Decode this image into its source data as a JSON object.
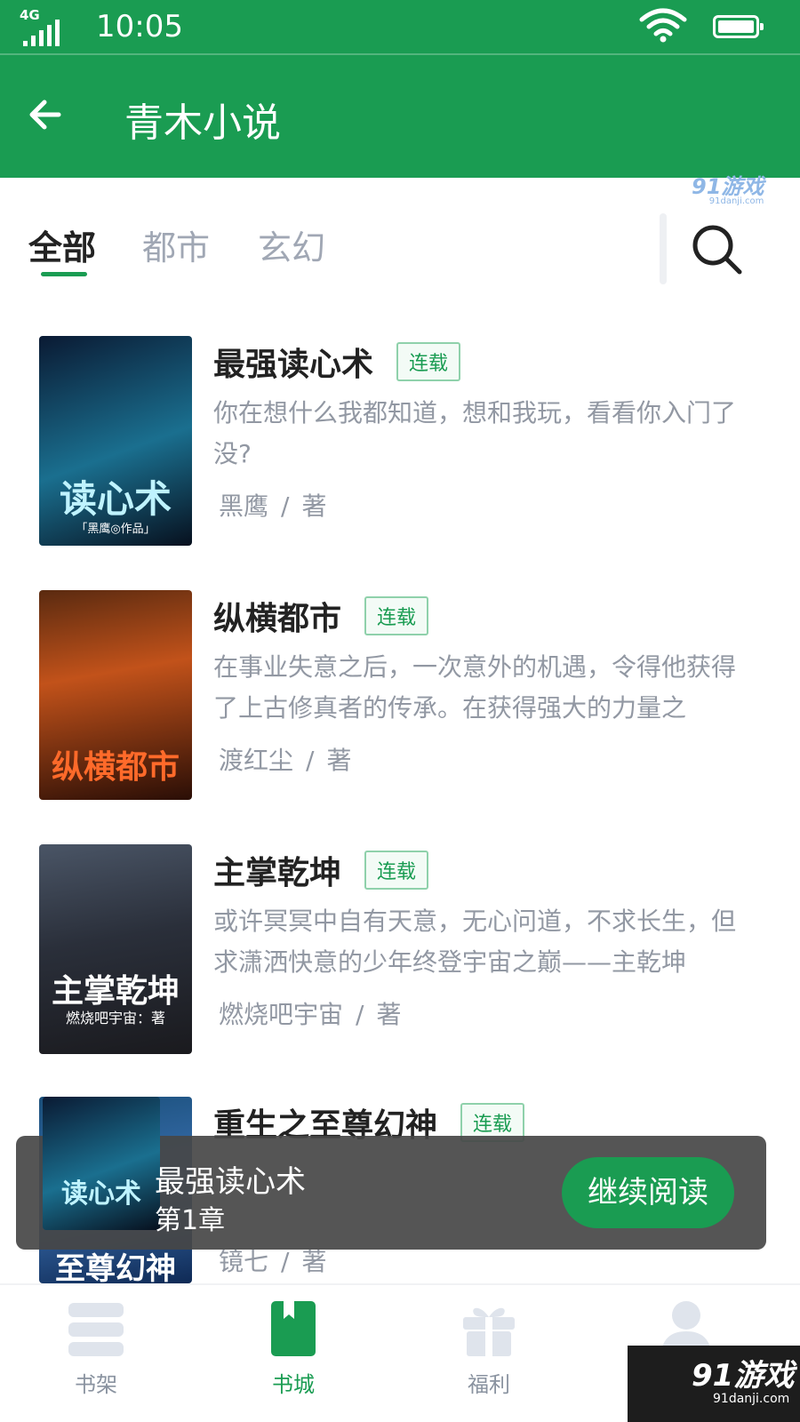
{
  "status_bar": {
    "network": "4G",
    "time": "10:05"
  },
  "app_bar": {
    "title": "青木小说"
  },
  "watermark_top": {
    "brand": "91游戏",
    "site": "91danji.com"
  },
  "tabs": [
    {
      "label": "全部",
      "active": true
    },
    {
      "label": "都市",
      "active": false
    },
    {
      "label": "玄幻",
      "active": false
    }
  ],
  "books": [
    {
      "title": "最强读心术",
      "status": "连载",
      "description": "你在想什么我都知道，想和我玩，看看你入门了没?",
      "author": "黑鹰",
      "by": "著",
      "cover_text": "读心术",
      "cover_sub": "「黑鹰◎作品」",
      "cover_colors": [
        "#0a1a33",
        "#1a6f8f"
      ]
    },
    {
      "title": "纵横都市",
      "status": "连载",
      "description": "在事业失意之后，一次意外的机遇，令得他获得了上古修真者的传承。在获得强大的力量之",
      "author": "渡红尘",
      "by": "著",
      "cover_text": "纵横都市",
      "cover_sub": "",
      "cover_colors": [
        "#3a1408",
        "#c2521a"
      ]
    },
    {
      "title": "主掌乾坤",
      "status": "连载",
      "description": "或许冥冥中自有天意，无心问道，不求长生，但求潇洒快意的少年终登宇宙之巅——主乾坤",
      "author": "燃烧吧宇宙",
      "by": "著",
      "cover_text": "主掌乾坤",
      "cover_sub": "燃烧吧宇宙：著",
      "cover_colors": [
        "#22262e",
        "#4a5566"
      ]
    },
    {
      "title": "重生之至尊幻神",
      "status": "连载",
      "description": "",
      "author": "镜七",
      "by": "著",
      "cover_text": "至尊幻神",
      "cover_sub": "",
      "cover_colors": [
        "#0f2a55",
        "#3a6fb0"
      ]
    }
  ],
  "continue_reading": {
    "title": "最强读心术",
    "chapter": "第1章",
    "button": "继续阅读"
  },
  "bottom_nav": [
    {
      "label": "书架",
      "active": false
    },
    {
      "label": "书城",
      "active": true
    },
    {
      "label": "福利",
      "active": false
    },
    {
      "label": "我的",
      "active": false
    }
  ],
  "watermark_bottom": {
    "brand": "91游戏",
    "site": "91danji.com"
  },
  "colors": {
    "brand_green": "#1a9c52",
    "muted_text": "#9298a3"
  }
}
